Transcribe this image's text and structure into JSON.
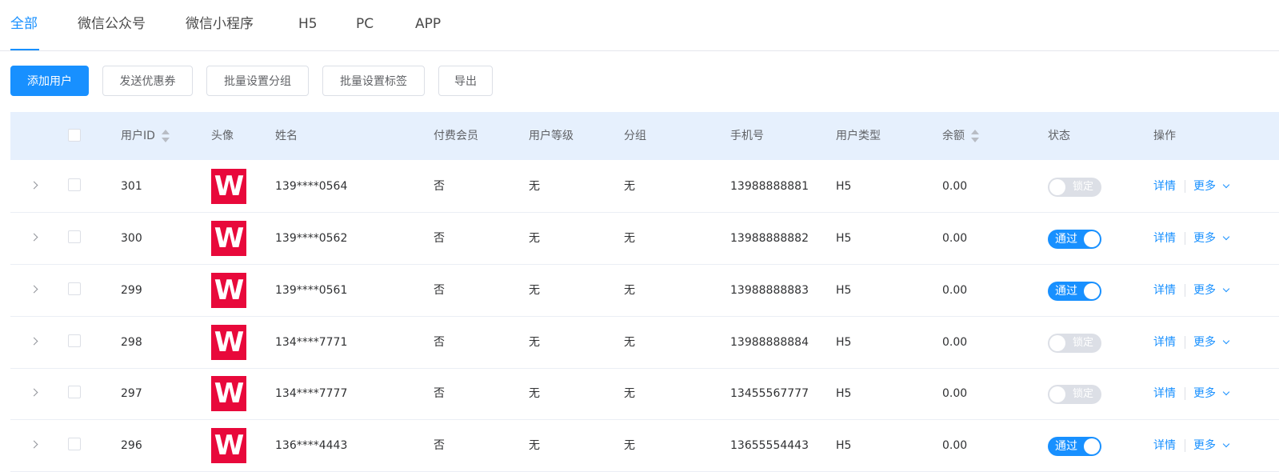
{
  "tabs": [
    {
      "label": "全部",
      "active": true
    },
    {
      "label": "微信公众号"
    },
    {
      "label": "微信小程序"
    },
    {
      "label": "H5"
    },
    {
      "label": "PC"
    },
    {
      "label": "APP"
    }
  ],
  "toolbar": {
    "add_user": "添加用户",
    "send_coupon": "发送优惠券",
    "batch_group": "批量设置分组",
    "batch_tag": "批量设置标签",
    "export": "导出"
  },
  "table": {
    "headers": {
      "user_id": "用户ID",
      "avatar": "头像",
      "name": "姓名",
      "paid_member": "付费会员",
      "level": "用户等级",
      "group": "分组",
      "phone": "手机号",
      "user_type": "用户类型",
      "balance": "余额",
      "status": "状态",
      "actions": "操作"
    },
    "rows": [
      {
        "id": "301",
        "avatar": "W",
        "name": "139****0564",
        "paid": "否",
        "level": "无",
        "group": "无",
        "phone": "13988888881",
        "type": "H5",
        "balance": "0.00",
        "status_on": false,
        "status": "锁定",
        "detail": "详情",
        "more": "更多"
      },
      {
        "id": "300",
        "avatar": "W",
        "name": "139****0562",
        "paid": "否",
        "level": "无",
        "group": "无",
        "phone": "13988888882",
        "type": "H5",
        "balance": "0.00",
        "status_on": true,
        "status": "通过",
        "detail": "详情",
        "more": "更多"
      },
      {
        "id": "299",
        "avatar": "W",
        "name": "139****0561",
        "paid": "否",
        "level": "无",
        "group": "无",
        "phone": "13988888883",
        "type": "H5",
        "balance": "0.00",
        "status_on": true,
        "status": "通过",
        "detail": "详情",
        "more": "更多"
      },
      {
        "id": "298",
        "avatar": "W",
        "name": "134****7771",
        "paid": "否",
        "level": "无",
        "group": "无",
        "phone": "13988888884",
        "type": "H5",
        "balance": "0.00",
        "status_on": false,
        "status": "锁定",
        "detail": "详情",
        "more": "更多"
      },
      {
        "id": "297",
        "avatar": "W",
        "name": "134****7777",
        "paid": "否",
        "level": "无",
        "group": "无",
        "phone": "13455567777",
        "type": "H5",
        "balance": "0.00",
        "status_on": false,
        "status": "锁定",
        "detail": "详情",
        "more": "更多"
      },
      {
        "id": "296",
        "avatar": "W",
        "name": "136****4443",
        "paid": "否",
        "level": "无",
        "group": "无",
        "phone": "13655554443",
        "type": "H5",
        "balance": "0.00",
        "status_on": true,
        "status": "通过",
        "detail": "详情",
        "more": "更多"
      }
    ]
  },
  "colors": {
    "primary": "#1890ff",
    "avatar_bg": "#e8093b",
    "header_bg": "#e6f0fd"
  }
}
